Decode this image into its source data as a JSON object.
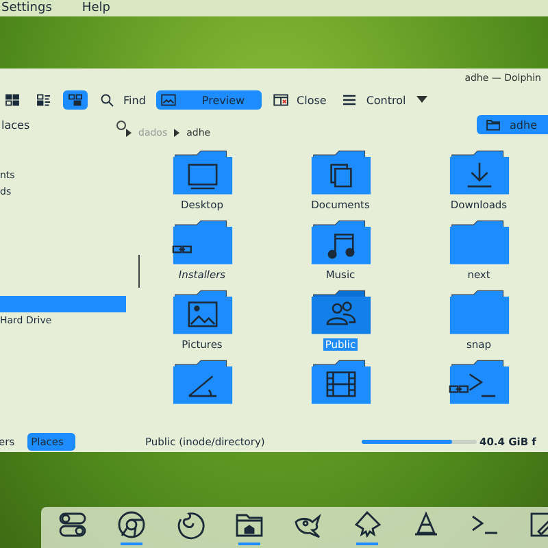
{
  "menubar": [
    "Settings",
    "Help"
  ],
  "window": {
    "title": "adhe — Dolphin"
  },
  "toolbar": [
    {
      "kind": "icons-view",
      "checked": false
    },
    {
      "kind": "compact-view",
      "checked": false
    },
    {
      "kind": "details-view",
      "checked": true
    },
    {
      "kind": "search",
      "label": "Find",
      "checked": false
    },
    {
      "kind": "preview",
      "label": "Preview",
      "checked": true
    },
    {
      "kind": "split",
      "label": "Close",
      "checked": false
    },
    {
      "kind": "menu",
      "label": "Control",
      "checked": false
    }
  ],
  "places": {
    "title": "laces",
    "items": [
      {
        "label": "nts",
        "selected": false
      },
      {
        "label": "ds",
        "selected": false
      },
      {
        "selected": true
      },
      {
        "label": "Hard Drive",
        "selected": false
      }
    ]
  },
  "location_tab": "adhe",
  "breadcrumb": [
    {
      "label": "dados",
      "current": false
    },
    {
      "label": "adhe",
      "current": true
    }
  ],
  "files": [
    {
      "name": "Desktop",
      "kind": "desktop",
      "symlink": false,
      "selected": false
    },
    {
      "name": "Documents",
      "kind": "documents",
      "symlink": false,
      "selected": false
    },
    {
      "name": "Downloads",
      "kind": "download",
      "symlink": false,
      "selected": false
    },
    {
      "name": "Installers",
      "kind": "plain",
      "symlink": true,
      "selected": false
    },
    {
      "name": "Music",
      "kind": "music",
      "symlink": false,
      "selected": false
    },
    {
      "name": "next",
      "kind": "plain",
      "symlink": false,
      "selected": false
    },
    {
      "name": "Pictures",
      "kind": "picture",
      "symlink": false,
      "selected": false
    },
    {
      "name": "Public",
      "kind": "people",
      "symlink": false,
      "selected": true
    },
    {
      "name": "snap",
      "kind": "plain",
      "symlink": false,
      "selected": false
    },
    {
      "kind": "template",
      "symlink": false,
      "selected": false
    },
    {
      "kind": "film",
      "symlink": false,
      "selected": false
    },
    {
      "kind": "terminal",
      "symlink": true,
      "selected": false
    }
  ],
  "panel_tabs": [
    {
      "label": "ers",
      "selected": false
    },
    {
      "label": "Places",
      "selected": true
    }
  ],
  "status": {
    "text": "Public (inode/directory)",
    "level": 0.78,
    "free": "40.4 GiB f"
  },
  "dock": [
    {
      "kind": "toggles",
      "running": false
    },
    {
      "kind": "browser",
      "running": true
    },
    {
      "kind": "fox",
      "running": false
    },
    {
      "kind": "files",
      "running": true
    },
    {
      "kind": "gimp",
      "running": false
    },
    {
      "kind": "inkscape",
      "running": true
    },
    {
      "kind": "cone",
      "running": false
    },
    {
      "kind": "terminal",
      "running": false
    },
    {
      "kind": "editor",
      "running": false
    }
  ]
}
